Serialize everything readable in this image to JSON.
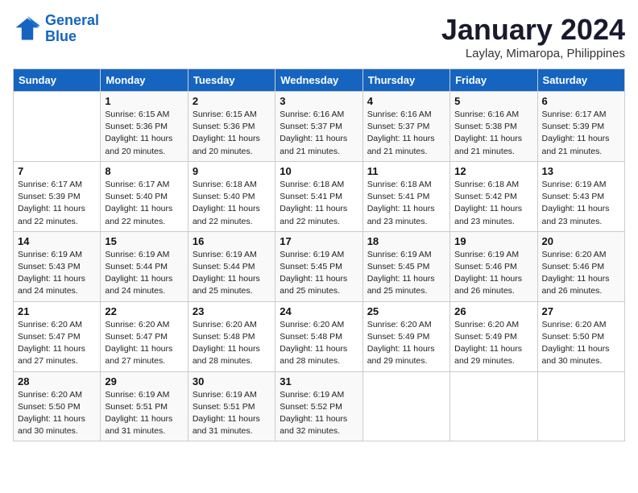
{
  "logo": {
    "line1": "General",
    "line2": "Blue"
  },
  "title": "January 2024",
  "subtitle": "Laylay, Mimaropa, Philippines",
  "days_of_week": [
    "Sunday",
    "Monday",
    "Tuesday",
    "Wednesday",
    "Thursday",
    "Friday",
    "Saturday"
  ],
  "weeks": [
    [
      {
        "day": "",
        "info": ""
      },
      {
        "day": "1",
        "info": "Sunrise: 6:15 AM\nSunset: 5:36 PM\nDaylight: 11 hours\nand 20 minutes."
      },
      {
        "day": "2",
        "info": "Sunrise: 6:15 AM\nSunset: 5:36 PM\nDaylight: 11 hours\nand 20 minutes."
      },
      {
        "day": "3",
        "info": "Sunrise: 6:16 AM\nSunset: 5:37 PM\nDaylight: 11 hours\nand 21 minutes."
      },
      {
        "day": "4",
        "info": "Sunrise: 6:16 AM\nSunset: 5:37 PM\nDaylight: 11 hours\nand 21 minutes."
      },
      {
        "day": "5",
        "info": "Sunrise: 6:16 AM\nSunset: 5:38 PM\nDaylight: 11 hours\nand 21 minutes."
      },
      {
        "day": "6",
        "info": "Sunrise: 6:17 AM\nSunset: 5:39 PM\nDaylight: 11 hours\nand 21 minutes."
      }
    ],
    [
      {
        "day": "7",
        "info": "Sunrise: 6:17 AM\nSunset: 5:39 PM\nDaylight: 11 hours\nand 22 minutes."
      },
      {
        "day": "8",
        "info": "Sunrise: 6:17 AM\nSunset: 5:40 PM\nDaylight: 11 hours\nand 22 minutes."
      },
      {
        "day": "9",
        "info": "Sunrise: 6:18 AM\nSunset: 5:40 PM\nDaylight: 11 hours\nand 22 minutes."
      },
      {
        "day": "10",
        "info": "Sunrise: 6:18 AM\nSunset: 5:41 PM\nDaylight: 11 hours\nand 22 minutes."
      },
      {
        "day": "11",
        "info": "Sunrise: 6:18 AM\nSunset: 5:41 PM\nDaylight: 11 hours\nand 23 minutes."
      },
      {
        "day": "12",
        "info": "Sunrise: 6:18 AM\nSunset: 5:42 PM\nDaylight: 11 hours\nand 23 minutes."
      },
      {
        "day": "13",
        "info": "Sunrise: 6:19 AM\nSunset: 5:43 PM\nDaylight: 11 hours\nand 23 minutes."
      }
    ],
    [
      {
        "day": "14",
        "info": "Sunrise: 6:19 AM\nSunset: 5:43 PM\nDaylight: 11 hours\nand 24 minutes."
      },
      {
        "day": "15",
        "info": "Sunrise: 6:19 AM\nSunset: 5:44 PM\nDaylight: 11 hours\nand 24 minutes."
      },
      {
        "day": "16",
        "info": "Sunrise: 6:19 AM\nSunset: 5:44 PM\nDaylight: 11 hours\nand 25 minutes."
      },
      {
        "day": "17",
        "info": "Sunrise: 6:19 AM\nSunset: 5:45 PM\nDaylight: 11 hours\nand 25 minutes."
      },
      {
        "day": "18",
        "info": "Sunrise: 6:19 AM\nSunset: 5:45 PM\nDaylight: 11 hours\nand 25 minutes."
      },
      {
        "day": "19",
        "info": "Sunrise: 6:19 AM\nSunset: 5:46 PM\nDaylight: 11 hours\nand 26 minutes."
      },
      {
        "day": "20",
        "info": "Sunrise: 6:20 AM\nSunset: 5:46 PM\nDaylight: 11 hours\nand 26 minutes."
      }
    ],
    [
      {
        "day": "21",
        "info": "Sunrise: 6:20 AM\nSunset: 5:47 PM\nDaylight: 11 hours\nand 27 minutes."
      },
      {
        "day": "22",
        "info": "Sunrise: 6:20 AM\nSunset: 5:47 PM\nDaylight: 11 hours\nand 27 minutes."
      },
      {
        "day": "23",
        "info": "Sunrise: 6:20 AM\nSunset: 5:48 PM\nDaylight: 11 hours\nand 28 minutes."
      },
      {
        "day": "24",
        "info": "Sunrise: 6:20 AM\nSunset: 5:48 PM\nDaylight: 11 hours\nand 28 minutes."
      },
      {
        "day": "25",
        "info": "Sunrise: 6:20 AM\nSunset: 5:49 PM\nDaylight: 11 hours\nand 29 minutes."
      },
      {
        "day": "26",
        "info": "Sunrise: 6:20 AM\nSunset: 5:49 PM\nDaylight: 11 hours\nand 29 minutes."
      },
      {
        "day": "27",
        "info": "Sunrise: 6:20 AM\nSunset: 5:50 PM\nDaylight: 11 hours\nand 30 minutes."
      }
    ],
    [
      {
        "day": "28",
        "info": "Sunrise: 6:20 AM\nSunset: 5:50 PM\nDaylight: 11 hours\nand 30 minutes."
      },
      {
        "day": "29",
        "info": "Sunrise: 6:19 AM\nSunset: 5:51 PM\nDaylight: 11 hours\nand 31 minutes."
      },
      {
        "day": "30",
        "info": "Sunrise: 6:19 AM\nSunset: 5:51 PM\nDaylight: 11 hours\nand 31 minutes."
      },
      {
        "day": "31",
        "info": "Sunrise: 6:19 AM\nSunset: 5:52 PM\nDaylight: 11 hours\nand 32 minutes."
      },
      {
        "day": "",
        "info": ""
      },
      {
        "day": "",
        "info": ""
      },
      {
        "day": "",
        "info": ""
      }
    ]
  ]
}
